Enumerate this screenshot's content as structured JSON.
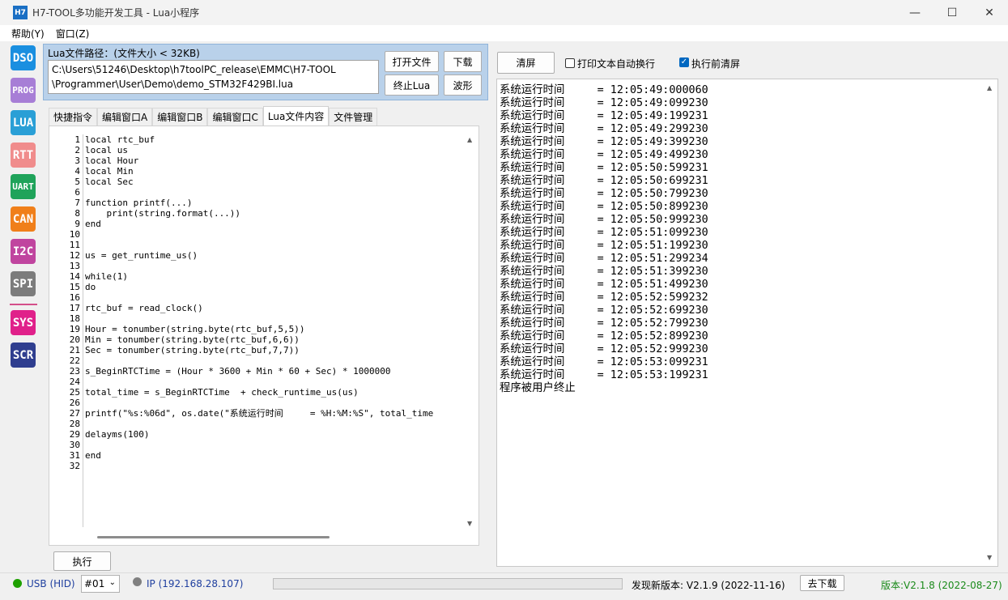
{
  "window": {
    "icon_text": "H7",
    "title": "H7-TOOL多功能开发工具 - Lua小程序",
    "minimize": "—",
    "maximize": "☐",
    "close": "✕"
  },
  "menu": {
    "help": "帮助(Y)",
    "window": "窗口(Z)"
  },
  "tools": [
    {
      "label": "DSO",
      "color": "#1a8fe0"
    },
    {
      "label": "PROG",
      "color": "#a77ed6"
    },
    {
      "label": "LUA",
      "color": "#2a9fd6"
    },
    {
      "label": "RTT",
      "color": "#f08c8c"
    },
    {
      "label": "UART",
      "color": "#1fa35a"
    },
    {
      "label": "CAN",
      "color": "#f07f1a"
    },
    {
      "label": "I2C",
      "color": "#c0459f"
    },
    {
      "label": "SPI",
      "color": "#7c7c7c"
    },
    {
      "label": "SYS",
      "color": "#e0208a"
    },
    {
      "label": "SCR",
      "color": "#2f3e8f"
    }
  ],
  "lua": {
    "path_label": "Lua文件路径：(文件大小 < 32KB)",
    "path_value": "C:\\Users\\51246\\Desktop\\h7toolPC_release\\EMMC\\H7-TOOL\n\\Programmer\\User\\Demo\\demo_STM32F429BI.lua",
    "open_file": "打开文件",
    "download": "下载",
    "stop_lua": "终止Lua",
    "waveform": "波形"
  },
  "tabs": [
    "快捷指令",
    "编辑窗口A",
    "编辑窗口B",
    "编辑窗口C",
    "Lua文件内容",
    "文件管理"
  ],
  "editor": {
    "line_numbers": "1\n2\n3\n4\n5\n6\n7\n8\n9\n10\n11\n12\n13\n14\n15\n16\n17\n18\n19\n20\n21\n22\n23\n24\n25\n26\n27\n28\n29\n30\n31\n32",
    "code": "local rtc_buf\nlocal us\nlocal Hour\nlocal Min\nlocal Sec\n\nfunction printf(...)\n    print(string.format(...))\nend\n\n\nus = get_runtime_us()\n\nwhile(1)\ndo\n\nrtc_buf = read_clock()\n\nHour = tonumber(string.byte(rtc_buf,5,5))\nMin = tonumber(string.byte(rtc_buf,6,6))\nSec = tonumber(string.byte(rtc_buf,7,7))\n\ns_BeginRTCTime = (Hour * 3600 + Min * 60 + Sec) * 1000000\n\ntotal_time = s_BeginRTCTime  + check_runtime_us(us)\n\nprintf(\"%s:%06d\", os.date(\"系统运行时间     = %H:%M:%S\", total_time\n\ndelayms(100)\n\nend"
  },
  "execute": "执行",
  "right": {
    "clear": "清屏",
    "auto_wrap": "打印文本自动换行",
    "auto_wrap_checked": false,
    "clear_before_run": "执行前清屏",
    "clear_before_run_checked": true
  },
  "output": "系统运行时间     = 12:05:49:000060\n系统运行时间     = 12:05:49:099230\n系统运行时间     = 12:05:49:199231\n系统运行时间     = 12:05:49:299230\n系统运行时间     = 12:05:49:399230\n系统运行时间     = 12:05:49:499230\n系统运行时间     = 12:05:50:599231\n系统运行时间     = 12:05:50:699231\n系统运行时间     = 12:05:50:799230\n系统运行时间     = 12:05:50:899230\n系统运行时间     = 12:05:50:999230\n系统运行时间     = 12:05:51:099230\n系统运行时间     = 12:05:51:199230\n系统运行时间     = 12:05:51:299234\n系统运行时间     = 12:05:51:399230\n系统运行时间     = 12:05:51:499230\n系统运行时间     = 12:05:52:599232\n系统运行时间     = 12:05:52:699230\n系统运行时间     = 12:05:52:799230\n系统运行时间     = 12:05:52:899230\n系统运行时间     = 12:05:52:999230\n系统运行时间     = 12:05:53:099231\n系统运行时间     = 12:05:53:199231\n程序被用户终止",
  "status": {
    "usb": "USB (HID)",
    "usb_color": "#1ea000",
    "device": "#01",
    "ip": "IP (192.168.28.107)",
    "ip_color": "#808080",
    "new_version": "发现新版本: V2.1.9 (2022-11-16)",
    "download": "去下载",
    "version": "版本:V2.1.8 (2022-08-27)",
    "version_color": "#1a8a1a"
  }
}
